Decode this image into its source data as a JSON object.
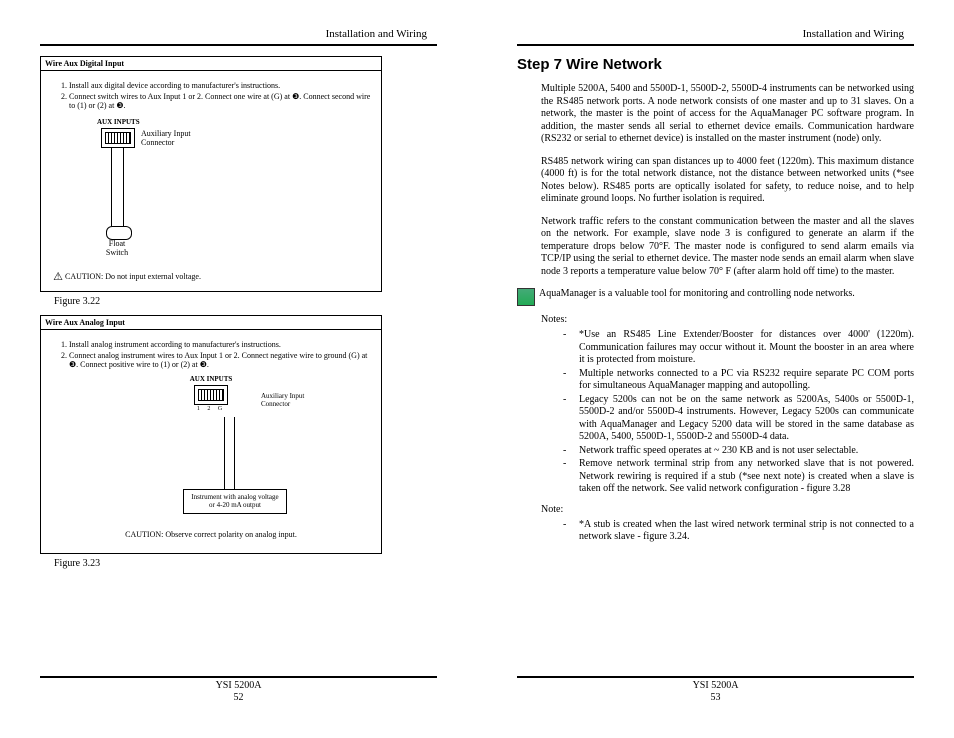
{
  "header": {
    "left": "Installation and Wiring",
    "right": "Installation and Wiring"
  },
  "footer": {
    "model": "YSI 5200A",
    "page_left": "52",
    "page_right": "53"
  },
  "fig1": {
    "title": "Wire Aux Digital Input",
    "step1": "Install aux digital device according to manufacturer's instructions.",
    "step2": "Connect switch wires to Aux Input 1 or 2. Connect one wire at (G) at ❸. Connect second wire to (1) or (2) at ❸.",
    "aux_label": "AUX INPUTS",
    "conn_text": "Auxiliary Input\nConnector",
    "float_text": "Float\nSwitch",
    "caution": "CAUTION: Do not input external voltage.",
    "caption": "Figure 3.22"
  },
  "fig2": {
    "title": "Wire Aux Analog Input",
    "step1": "Install analog instrument according to manufacturer's instructions.",
    "step2": "Connect analog instrument wires to Aux Input 1 or 2. Connect negative wire to ground (G) at ❸. Connect positive wire to (1) or (2) at ❸.",
    "aux_label": "AUX INPUTS",
    "conn_text": "Auxiliary Input\nConnector",
    "nums": "1 2 G",
    "instrument": "Instrument with analog voltage or 4-20 mA output",
    "caution": "CAUTION: Observe correct polarity on analog input.",
    "caption": "Figure 3.23"
  },
  "right": {
    "heading": "Step 7 Wire Network",
    "p1": "Multiple 5200A, 5400 and 5500D-1, 5500D-2, 5500D-4 instruments can be networked using the RS485 network ports. A node network consists of one master and up to 31 slaves. On a network, the master is the point of access for the AquaManager PC software program. In addition, the master sends all serial to ethernet device emails. Communication hardware (RS232 or serial to ethernet device) is installed on the master instrument (node) only.",
    "p2": "RS485 network wiring can span distances up to 4000 feet (1220m). This maximum distance (4000 ft) is for the total network distance, not the distance between networked units (*see Notes below). RS485 ports are optically isolated for safety, to reduce noise, and to help eliminate ground loops. No further isolation is required.",
    "p3": "Network traffic refers to the constant communication between the master and all the slaves on the network. For example, slave node 3 is configured to generate an alarm if the temperature drops below 70°F. The master node is configured to send alarm emails via TCP/IP using the serial to ethernet device. The master node sends an email alarm when slave node 3 reports a temperature value below 70° F (after alarm hold off time) to the master.",
    "icon_note": "AquaManager is a valuable tool for monitoring and controlling node networks.",
    "notes_label": "Notes:",
    "notes": [
      "*Use an RS485 Line Extender/Booster for distances over 4000' (1220m). Communication failures may occur without it. Mount the booster in an area where it is protected from moisture.",
      "Multiple networks connected to a PC via RS232 require separate PC COM ports for simultaneous AquaManager mapping and autopolling.",
      "Legacy 5200s can not be on the same network as 5200As, 5400s or 5500D-1, 5500D-2 and/or 5500D-4 instruments. However, Legacy 5200s can communicate with AquaManager and Legacy 5200 data will be stored in the same database as 5200A, 5400, 5500D-1, 5500D-2 and 5500D-4 data.",
      "Network traffic speed operates at ~ 230 KB and is not user selectable.",
      "Remove network terminal strip from any networked slave that is not powered. Network rewiring is required if a stub (*see next note) is created when a slave is taken off the network. See valid network configuration - figure 3.28"
    ],
    "note2_label": "Note:",
    "note2": "*A stub is created when the last wired network terminal strip is not connected to a network slave - figure 3.24."
  }
}
